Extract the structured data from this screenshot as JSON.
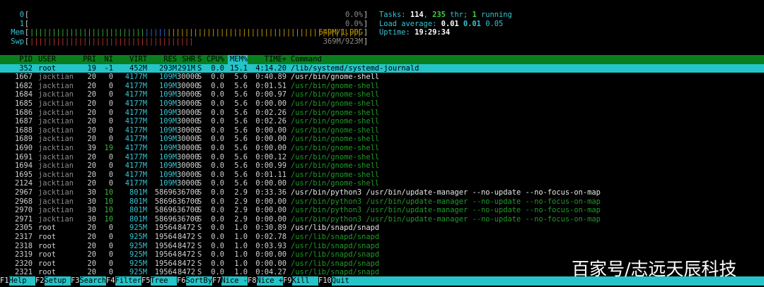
{
  "meters": {
    "cpu0": {
      "label": "0",
      "value": "0.0%"
    },
    "cpu1": {
      "label": "1",
      "value": "0.0%"
    },
    "mem": {
      "label": "Mem",
      "value": "649M/1.90G"
    },
    "swp": {
      "label": "Swp",
      "value": "369M/923M"
    }
  },
  "info": {
    "tasks_label": "Tasks:",
    "tasks": "114",
    "threads": "235",
    "threads_label": "thr;",
    "running": "1",
    "running_label": "running",
    "load_label": "Load average:",
    "load1": "0.01",
    "load5": "0.01",
    "load15": "0.05",
    "uptime_label": "Uptime:",
    "uptime": "19:29:34"
  },
  "columns": {
    "pid": "PID",
    "user": "USER",
    "pri": "PRI",
    "ni": "NI",
    "virt": "VIRT",
    "res": "RES",
    "shr": "SHR",
    "s": "S",
    "cpu": "CPU%",
    "mem": "MEM%",
    "time": "TIME+",
    "cmd": "Command"
  },
  "processes": [
    {
      "pid": "352",
      "user": "root",
      "pri": "19",
      "ni": "-1",
      "virt": "452M",
      "res": "293M",
      "shr": "291M",
      "s": "S",
      "cpu": "0.0",
      "mem": "15.1",
      "time": "4:14.20",
      "cmd": "/lib/systemd/systemd-journald"
    },
    {
      "pid": "1667",
      "user": "jacktian",
      "pri": "20",
      "ni": "0",
      "virt": "4177M",
      "res": "109M",
      "shr": "30000",
      "s": "S",
      "cpu": "0.0",
      "mem": "5.6",
      "time": "0:40.89",
      "cmd": "/usr/bin/gnome-shell"
    },
    {
      "pid": "1682",
      "user": "jacktian",
      "pri": "20",
      "ni": "0",
      "virt": "4177M",
      "res": "109M",
      "shr": "30000",
      "s": "S",
      "cpu": "0.0",
      "mem": "5.6",
      "time": "0:01.51",
      "cmd": "/usr/bin/gnome-shell"
    },
    {
      "pid": "1684",
      "user": "jacktian",
      "pri": "20",
      "ni": "0",
      "virt": "4177M",
      "res": "109M",
      "shr": "30000",
      "s": "S",
      "cpu": "0.0",
      "mem": "5.6",
      "time": "0:00.97",
      "cmd": "/usr/bin/gnome-shell"
    },
    {
      "pid": "1685",
      "user": "jacktian",
      "pri": "20",
      "ni": "0",
      "virt": "4177M",
      "res": "109M",
      "shr": "30000",
      "s": "S",
      "cpu": "0.0",
      "mem": "5.6",
      "time": "0:00.00",
      "cmd": "/usr/bin/gnome-shell"
    },
    {
      "pid": "1686",
      "user": "jacktian",
      "pri": "20",
      "ni": "0",
      "virt": "4177M",
      "res": "109M",
      "shr": "30000",
      "s": "S",
      "cpu": "0.0",
      "mem": "5.6",
      "time": "0:02.26",
      "cmd": "/usr/bin/gnome-shell"
    },
    {
      "pid": "1687",
      "user": "jacktian",
      "pri": "20",
      "ni": "0",
      "virt": "4177M",
      "res": "109M",
      "shr": "30000",
      "s": "S",
      "cpu": "0.0",
      "mem": "5.6",
      "time": "0:02.26",
      "cmd": "/usr/bin/gnome-shell"
    },
    {
      "pid": "1688",
      "user": "jacktian",
      "pri": "20",
      "ni": "0",
      "virt": "4177M",
      "res": "109M",
      "shr": "30000",
      "s": "S",
      "cpu": "0.0",
      "mem": "5.6",
      "time": "0:00.00",
      "cmd": "/usr/bin/gnome-shell"
    },
    {
      "pid": "1689",
      "user": "jacktian",
      "pri": "20",
      "ni": "0",
      "virt": "4177M",
      "res": "109M",
      "shr": "30000",
      "s": "S",
      "cpu": "0.0",
      "mem": "5.6",
      "time": "0:00.00",
      "cmd": "/usr/bin/gnome-shell"
    },
    {
      "pid": "1690",
      "user": "jacktian",
      "pri": "39",
      "ni": "19",
      "virt": "4177M",
      "res": "109M",
      "shr": "30000",
      "s": "S",
      "cpu": "0.0",
      "mem": "5.6",
      "time": "0:00.00",
      "cmd": "/usr/bin/gnome-shell"
    },
    {
      "pid": "1691",
      "user": "jacktian",
      "pri": "20",
      "ni": "0",
      "virt": "4177M",
      "res": "109M",
      "shr": "30000",
      "s": "S",
      "cpu": "0.0",
      "mem": "5.6",
      "time": "0:00.12",
      "cmd": "/usr/bin/gnome-shell"
    },
    {
      "pid": "1694",
      "user": "jacktian",
      "pri": "20",
      "ni": "0",
      "virt": "4177M",
      "res": "109M",
      "shr": "30000",
      "s": "S",
      "cpu": "0.0",
      "mem": "5.6",
      "time": "0:00.99",
      "cmd": "/usr/bin/gnome-shell"
    },
    {
      "pid": "1695",
      "user": "jacktian",
      "pri": "20",
      "ni": "0",
      "virt": "4177M",
      "res": "109M",
      "shr": "30000",
      "s": "S",
      "cpu": "0.0",
      "mem": "5.6",
      "time": "0:01.11",
      "cmd": "/usr/bin/gnome-shell"
    },
    {
      "pid": "2124",
      "user": "jacktian",
      "pri": "20",
      "ni": "0",
      "virt": "4177M",
      "res": "109M",
      "shr": "30000",
      "s": "S",
      "cpu": "0.0",
      "mem": "5.6",
      "time": "0:00.00",
      "cmd": "/usr/bin/gnome-shell"
    },
    {
      "pid": "2967",
      "user": "jacktian",
      "pri": "30",
      "ni": "10",
      "virt": "801M",
      "res": "58696",
      "shr": "36700",
      "s": "S",
      "cpu": "0.0",
      "mem": "2.9",
      "time": "0:33.36",
      "cmd": "/usr/bin/python3 /usr/bin/update-manager --no-update --no-focus-on-map"
    },
    {
      "pid": "2968",
      "user": "jacktian",
      "pri": "30",
      "ni": "10",
      "virt": "801M",
      "res": "58696",
      "shr": "36700",
      "s": "S",
      "cpu": "0.0",
      "mem": "2.9",
      "time": "0:00.00",
      "cmd": "/usr/bin/python3 /usr/bin/update-manager --no-update --no-focus-on-map"
    },
    {
      "pid": "2970",
      "user": "jacktian",
      "pri": "30",
      "ni": "10",
      "virt": "801M",
      "res": "58696",
      "shr": "36700",
      "s": "S",
      "cpu": "0.0",
      "mem": "2.9",
      "time": "0:00.00",
      "cmd": "/usr/bin/python3 /usr/bin/update-manager --no-update --no-focus-on-map"
    },
    {
      "pid": "2971",
      "user": "jacktian",
      "pri": "30",
      "ni": "10",
      "virt": "801M",
      "res": "58696",
      "shr": "36700",
      "s": "S",
      "cpu": "0.0",
      "mem": "2.9",
      "time": "0:00.00",
      "cmd": "/usr/bin/python3 /usr/bin/update-manager --no-update --no-focus-on-map"
    },
    {
      "pid": "2305",
      "user": "root",
      "pri": "20",
      "ni": "0",
      "virt": "925M",
      "res": "19564",
      "shr": "8472",
      "s": "S",
      "cpu": "0.0",
      "mem": "1.0",
      "time": "0:30.89",
      "cmd": "/usr/lib/snapd/snapd"
    },
    {
      "pid": "2317",
      "user": "root",
      "pri": "20",
      "ni": "0",
      "virt": "925M",
      "res": "19564",
      "shr": "8472",
      "s": "S",
      "cpu": "0.0",
      "mem": "1.0",
      "time": "0:02.78",
      "cmd": "/usr/lib/snapd/snapd"
    },
    {
      "pid": "2318",
      "user": "root",
      "pri": "20",
      "ni": "0",
      "virt": "925M",
      "res": "19564",
      "shr": "8472",
      "s": "S",
      "cpu": "0.0",
      "mem": "1.0",
      "time": "0:03.93",
      "cmd": "/usr/lib/snapd/snapd"
    },
    {
      "pid": "2319",
      "user": "root",
      "pri": "20",
      "ni": "0",
      "virt": "925M",
      "res": "19564",
      "shr": "8472",
      "s": "S",
      "cpu": "0.0",
      "mem": "1.0",
      "time": "0:00.00",
      "cmd": "/usr/lib/snapd/snapd"
    },
    {
      "pid": "2320",
      "user": "root",
      "pri": "20",
      "ni": "0",
      "virt": "925M",
      "res": "19564",
      "shr": "8472",
      "s": "S",
      "cpu": "0.0",
      "mem": "1.0",
      "time": "0:00.00",
      "cmd": "/usr/lib/snapd/snapd"
    },
    {
      "pid": "2321",
      "user": "root",
      "pri": "20",
      "ni": "0",
      "virt": "925M",
      "res": "19564",
      "shr": "8472",
      "s": "S",
      "cpu": "0.0",
      "mem": "1.0",
      "time": "0:04.27",
      "cmd": "/usr/lib/snapd/snapd"
    }
  ],
  "footer": [
    {
      "key": "F1",
      "label": "Help"
    },
    {
      "key": "F2",
      "label": "Setup"
    },
    {
      "key": "F3",
      "label": "Search"
    },
    {
      "key": "F4",
      "label": "Filter"
    },
    {
      "key": "F5",
      "label": "Tree"
    },
    {
      "key": "F6",
      "label": "SortBy"
    },
    {
      "key": "F7",
      "label": "Nice -"
    },
    {
      "key": "F8",
      "label": "Nice +"
    },
    {
      "key": "F9",
      "label": "Kill"
    },
    {
      "key": "F10",
      "label": "Quit"
    }
  ],
  "watermark": "百家号/志远天辰科技",
  "colors": {
    "header_bg": "#0a7e1e",
    "selected_bg": "#24c4c8",
    "accent_cyan": "#35c4d4",
    "thread_green": "#1f9a28"
  }
}
